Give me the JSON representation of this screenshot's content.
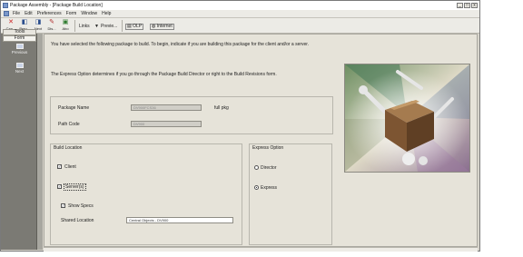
{
  "window": {
    "title": "Package Assembly - [Package Build Location]",
    "controls": [
      "_",
      "□",
      "x"
    ]
  },
  "menu": [
    "File",
    "Edit",
    "Preferences",
    "Form",
    "Window",
    "Help"
  ],
  "toolbar": {
    "buttons": [
      {
        "label": "Can...",
        "icon": "close-icon",
        "color": "#cc2222"
      },
      {
        "label": "Prev...",
        "icon": "arrow-left-icon",
        "color": "#2a4d8c"
      },
      {
        "label": "Next",
        "icon": "arrow-right-icon",
        "color": "#2a4d8c"
      },
      {
        "label": "Dis...",
        "icon": "display-icon",
        "color": "#b23030"
      },
      {
        "label": "Abo",
        "icon": "about-icon",
        "color": "#2d7a2d"
      }
    ],
    "links_label": "Links",
    "preview_label": "Previe...",
    "olp_label": "OLP",
    "internet_label": "Internet"
  },
  "rail": {
    "tools_label": "Tools",
    "form_label": "Form",
    "items": [
      "Previous",
      "Next"
    ]
  },
  "main": {
    "intro1": "You have selected the following package to build. To begin, indicate if you are building this package for the client and/or a server.",
    "intro2": "The Express Option determines if you go through the Package Build Director or right to the Build Revisions form.",
    "package_name_label": "Package Name",
    "package_name_value": "DV900FCS36",
    "package_type": "full pkg",
    "path_code_label": "Path Code",
    "path_code_value": "DV900",
    "build_location_title": "Build Location",
    "client_label": "Client",
    "client_checked": true,
    "servers_label": "Server(s)",
    "servers_checked": true,
    "show_specs_label": "Show Specs",
    "show_specs_checked": true,
    "shared_location_label": "Shared Location",
    "shared_location_value": "Central Objects - DV900",
    "express_title": "Express Option",
    "director_label": "Director",
    "express_label": "Express",
    "selected_option": "Express"
  }
}
